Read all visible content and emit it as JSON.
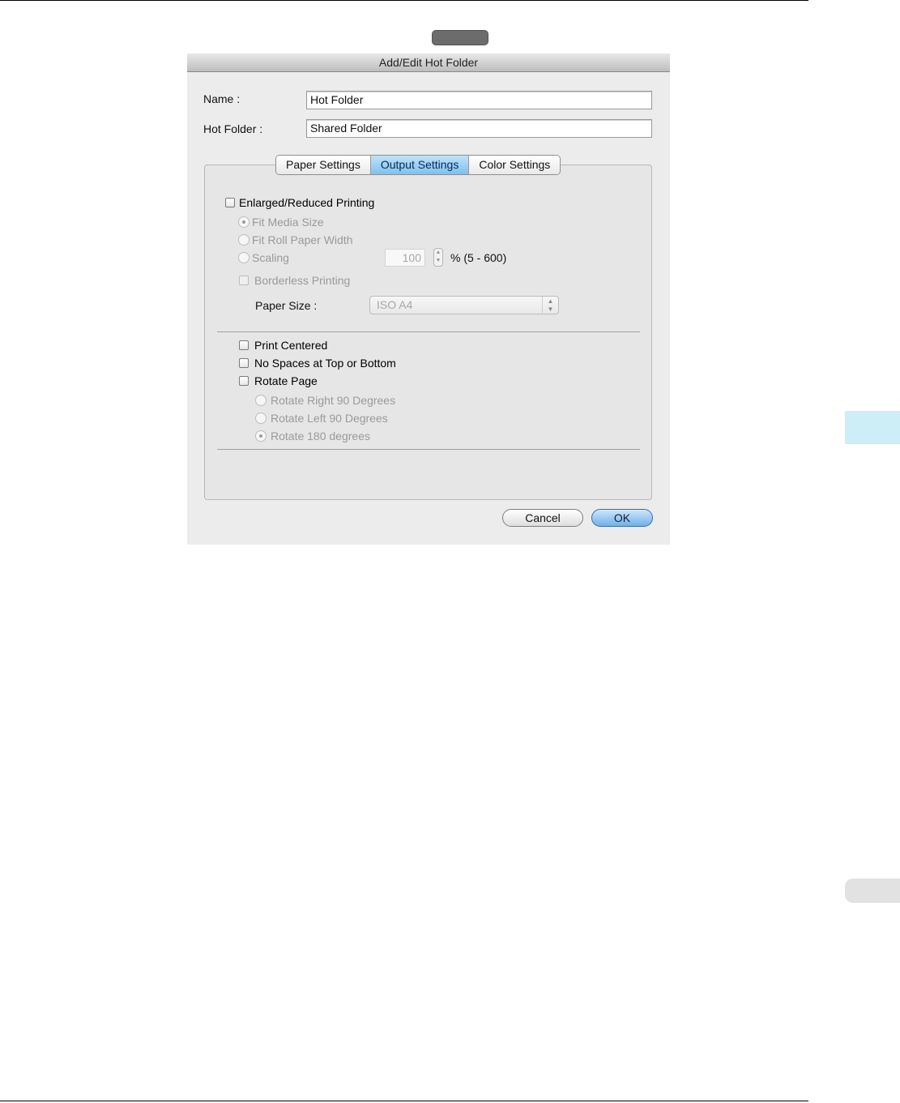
{
  "dialog": {
    "title": "Add/Edit Hot Folder",
    "name_label": "Name :",
    "name_value": "Hot Folder",
    "hot_folder_label": "Hot Folder :",
    "hot_folder_value": "Shared Folder",
    "tabs": [
      {
        "label": "Paper Settings",
        "active": false
      },
      {
        "label": "Output Settings",
        "active": true
      },
      {
        "label": "Color Settings",
        "active": false
      }
    ],
    "output": {
      "enlarged_reduced": "Enlarged/Reduced Printing",
      "fit_media_size": "Fit Media Size",
      "fit_roll_paper_width": "Fit Roll Paper Width",
      "scaling": "Scaling",
      "scaling_value": "100",
      "scaling_range": "% (5 - 600)",
      "borderless_printing": "Borderless Printing",
      "paper_size_label": "Paper Size :",
      "paper_size_value": "ISO A4",
      "print_centered": "Print Centered",
      "no_spaces": "No Spaces at Top or Bottom",
      "rotate_page": "Rotate Page",
      "rotate_right": "Rotate Right 90 Degrees",
      "rotate_left": "Rotate Left 90 Degrees",
      "rotate_180": "Rotate 180 degrees"
    },
    "buttons": {
      "cancel": "Cancel",
      "ok": "OK"
    }
  },
  "colors": {
    "active_tab": "#7ec0ef",
    "side_tab": "#cdeef7"
  }
}
